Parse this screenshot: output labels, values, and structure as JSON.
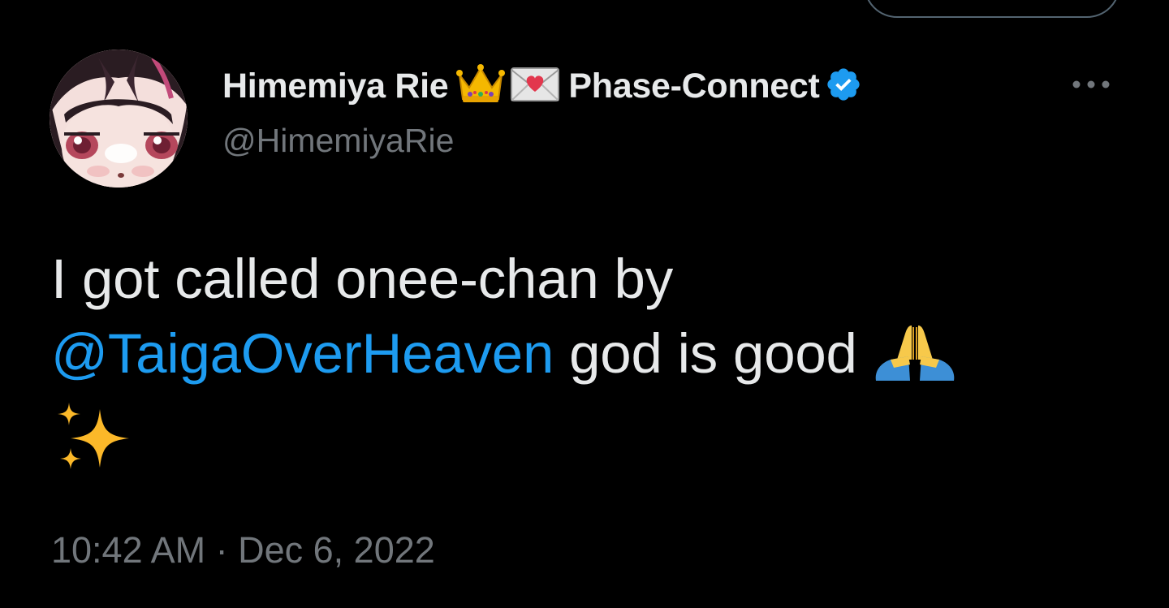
{
  "tweet": {
    "author": {
      "display_name": "Himemiya Rie",
      "name_emojis": [
        "crown-icon",
        "love-letter-icon"
      ],
      "org": "Phase-Connect",
      "verified": true,
      "handle": "@HimemiyaRie"
    },
    "text_before_mention": "I got called onee-chan by",
    "mention": "@TaigaOverHeaven",
    "text_after_mention": " god is good ",
    "trailing_emojis": [
      "folded-hands-icon",
      "sparkles-icon"
    ],
    "timestamp": "10:42 AM · Dec 6, 2022"
  },
  "colors": {
    "background": "#000000",
    "text_primary": "#e7e9ea",
    "text_secondary": "#71767b",
    "accent": "#1d9bf0"
  }
}
